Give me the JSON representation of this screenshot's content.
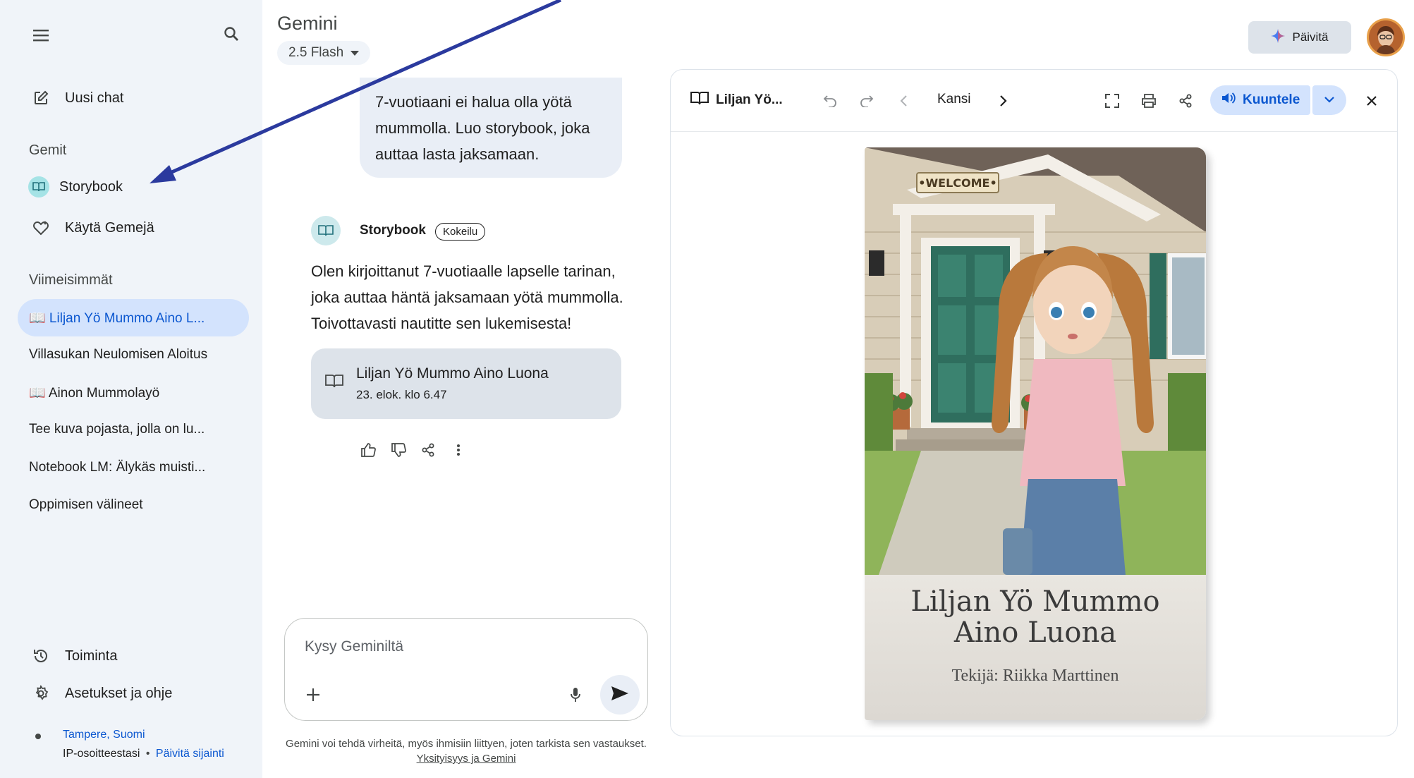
{
  "sidebar": {
    "new_chat": "Uusi chat",
    "gems_heading": "Gemit",
    "gems": [
      {
        "label": "Storybook"
      },
      {
        "label": "Käytä Gemejä"
      }
    ],
    "recent_heading": "Viimeisimmät",
    "recent": [
      {
        "label": "📖 Liljan Yö Mummo Aino L..."
      },
      {
        "label": "Villasukan Neulomisen Aloitus"
      },
      {
        "label": "📖 Ainon Mummolayö"
      },
      {
        "label": "Tee kuva pojasta, jolla on lu..."
      },
      {
        "label": "Notebook LM: Älykäs muisti..."
      },
      {
        "label": "Oppimisen välineet"
      }
    ],
    "activity": "Toiminta",
    "settings": "Asetukset ja ohje",
    "location": {
      "city": "Tampere, Suomi",
      "source": "IP-osoitteestasi",
      "separator": "•",
      "update": "Päivitä sijainti"
    }
  },
  "header": {
    "title": "Gemini",
    "model": "2.5 Flash",
    "upgrade": "Päivitä"
  },
  "chat": {
    "user_message": "7-vuotiaani ei halua olla yötä mummolla. Luo storybook, joka auttaa lasta jaksamaan.",
    "responder": "Storybook",
    "badge": "Kokeilu",
    "response": "Olen kirjoittanut 7-vuotiaalle lapselle tarinan, joka auttaa häntä jaksamaan yötä mummolla. Toivottavasti nautitte sen lukemisesta!",
    "doc_title": "Liljan Yö Mummo Aino Luona",
    "doc_date": "23. elok. klo 6.47"
  },
  "input": {
    "placeholder": "Kysy Geminiltä"
  },
  "disclaimer": {
    "text": "Gemini voi tehdä virheitä, myös ihmisiin liittyen, joten tarkista sen vastaukset.",
    "link": "Yksityisyys ja Gemini"
  },
  "panel": {
    "title": "Liljan Yö...",
    "page": "Kansi",
    "listen": "Kuuntele"
  },
  "book": {
    "sign": "•WELCOME•",
    "title": "Liljan Yö Mummo Aino Luona",
    "author": "Tekijä: Riikka Marttinen"
  },
  "colors": {
    "sidebar_bg": "#f0f4f9",
    "active_bg": "#d3e3fd",
    "accent": "#0b57d0",
    "annotation_arrow": "#2b3a9e"
  },
  "icons": [
    "menu-icon",
    "search-icon",
    "edit-icon",
    "book-icon",
    "gem-heart-icon",
    "history-icon",
    "gear-icon",
    "dropdown-icon",
    "sparkle-icon",
    "thumb-up-icon",
    "thumb-down-icon",
    "share-icon",
    "more-icon",
    "plus-icon",
    "mic-icon",
    "send-icon",
    "undo-icon",
    "redo-icon",
    "chevron-left-icon",
    "chevron-right-icon",
    "fullscreen-icon",
    "print-icon",
    "speaker-icon",
    "chevron-down-icon",
    "close-icon"
  ]
}
